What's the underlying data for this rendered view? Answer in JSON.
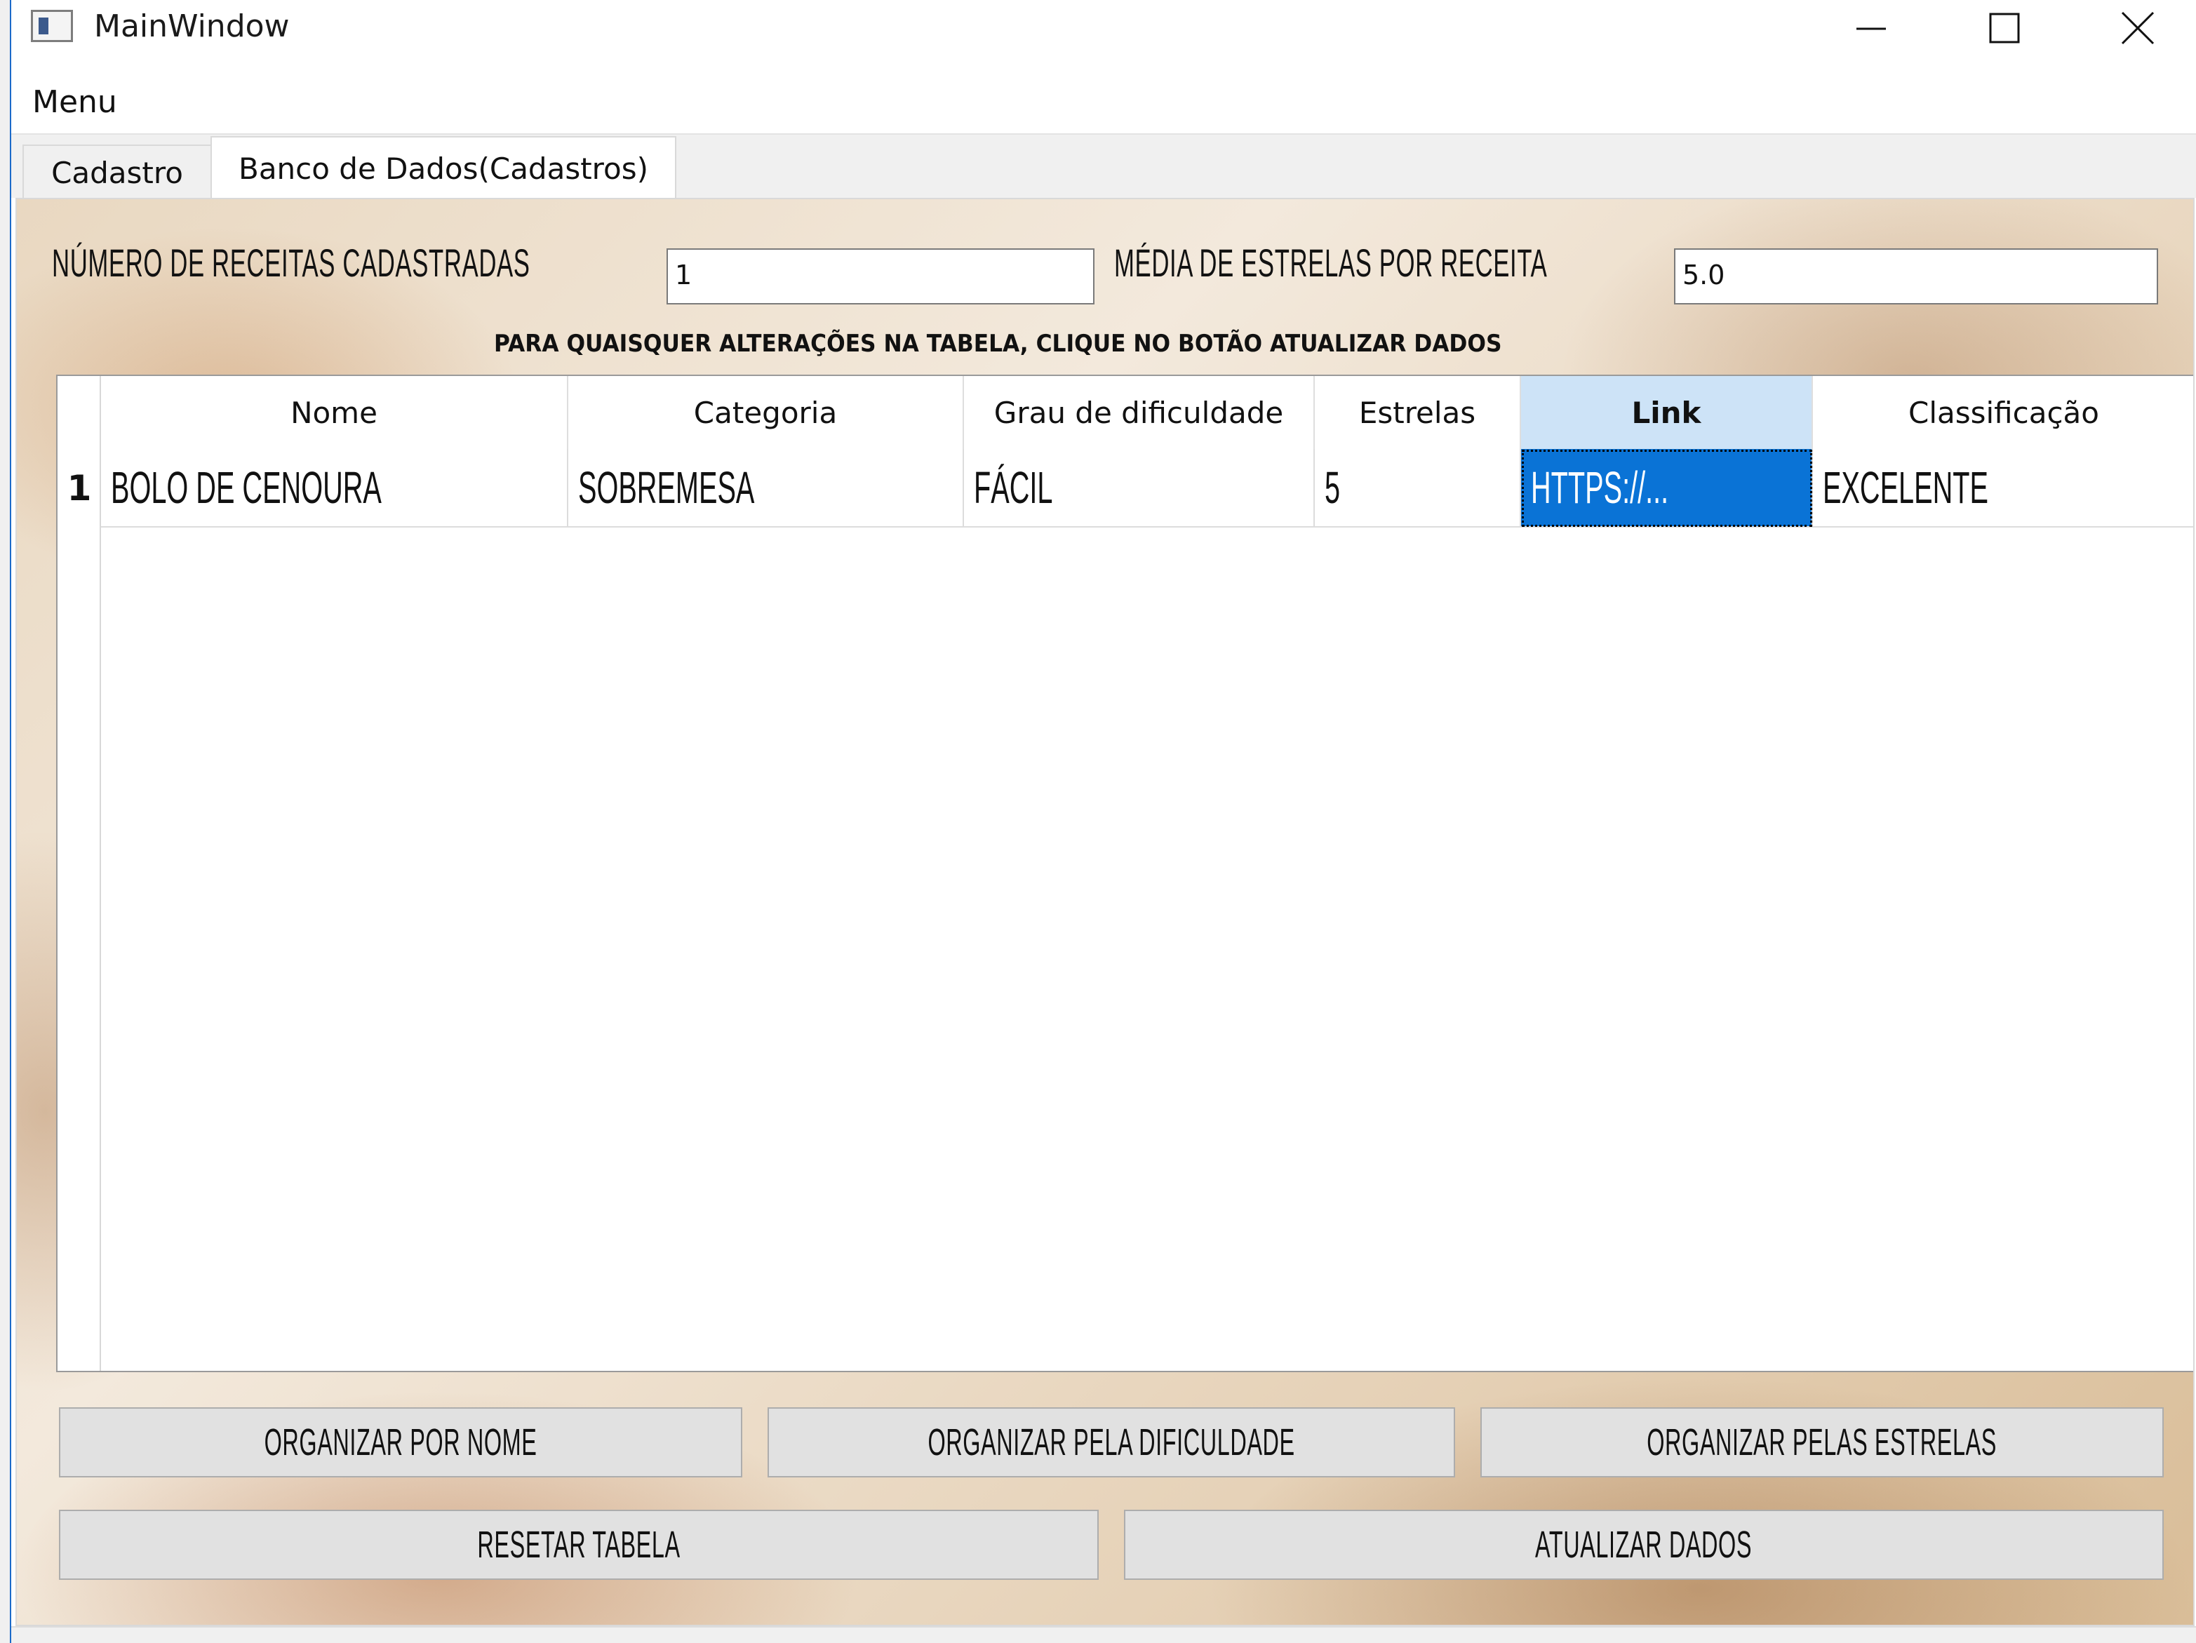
{
  "window": {
    "title": "MainWindow",
    "accent_color": "#1b6ac9"
  },
  "menubar": {
    "items": [
      "Menu"
    ]
  },
  "tabs": [
    {
      "label": "Cadastro",
      "active": false
    },
    {
      "label": "Banco de Dados(Cadastros)",
      "active": true
    }
  ],
  "stats": {
    "recipes_label": "NÚMERO DE RECEITAS CADASTRADAS",
    "recipes_value": "1",
    "stars_label": "MÉDIA DE ESTRELAS POR RECEITA",
    "stars_value": "5.0"
  },
  "notice": "PARA QUAISQUER ALTERAÇÕES NA TABELA, CLIQUE NO BOTÃO ATUALIZAR DADOS",
  "table": {
    "columns": [
      "Nome",
      "Categoria",
      "Grau de dificuldade",
      "Estrelas",
      "Link",
      "Classificação"
    ],
    "selected_column": 4,
    "rows": [
      {
        "number": "1",
        "cells": [
          "BOLO DE CENOURA",
          "SOBREMESA",
          "FÁCIL",
          "5",
          "HTTPS://...",
          "EXCELENTE"
        ]
      }
    ],
    "selection_color": "#0a73d6"
  },
  "buttons": {
    "sort_name": "ORGANIZAR POR NOME",
    "sort_difficulty": "ORGANIZAR PELA DIFICULDADE",
    "sort_stars": "ORGANIZAR PELAS ESTRELAS",
    "reset_table": "RESETAR TABELA",
    "update_data": "ATUALIZAR DADOS"
  }
}
